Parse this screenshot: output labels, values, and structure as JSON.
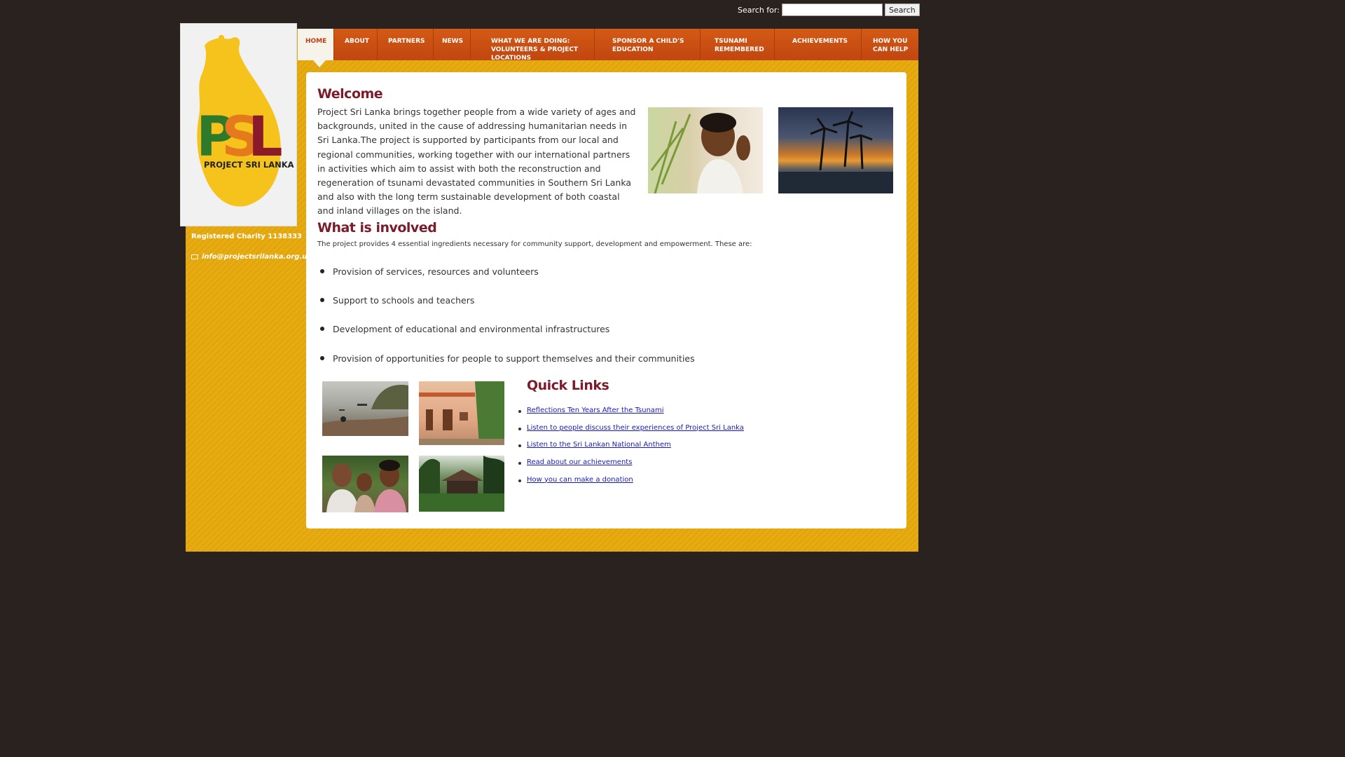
{
  "search": {
    "label": "Search for:",
    "value": "",
    "button": "Search"
  },
  "nav": {
    "items": [
      {
        "lines": [
          "HOME"
        ]
      },
      {
        "lines": [
          "ABOUT"
        ]
      },
      {
        "lines": [
          "PARTNERS"
        ]
      },
      {
        "lines": [
          "NEWS"
        ]
      },
      {
        "lines": [
          "WHAT WE ARE DOING:",
          "VOLUNTEERS & PROJECT",
          "LOCATIONS"
        ]
      },
      {
        "lines": [
          "SPONSOR A CHILD'S",
          "EDUCATION"
        ]
      },
      {
        "lines": [
          "TSUNAMI",
          "REMEMBERED"
        ]
      },
      {
        "lines": [
          "ACHIEVEMENTS"
        ]
      },
      {
        "lines": [
          "HOW YOU",
          "CAN HELP"
        ]
      }
    ],
    "active": "HOME"
  },
  "logo": {
    "letters": "PSL",
    "subtitle": "PROJECT SRI LANKA"
  },
  "sidebar": {
    "charity": "Registered Charity 1138333",
    "email": "info@projectsrilanka.org.uk"
  },
  "welcome": {
    "title": "Welcome",
    "body": "Project Sri Lanka brings together people from a wide variety of ages and backgrounds, united in the cause of addressing humanitarian needs in Sri Lanka.The project is supported by participants from our local and regional communities, working together with our international partners in activities which aim to assist with both the reconstruction and regeneration of tsunami devastated communities in Southern Sri Lanka and also with the long term sustainable development of both coastal and inland villages on the island."
  },
  "involved": {
    "title": "What is involved",
    "intro": "The project provides 4 essential ingredients necessary for community support, development and empowerment. These are:",
    "items": [
      "Provision of services, resources and volunteers",
      "Support to schools and teachers",
      "Development of educational and environmental infrastructures",
      "Provision of opportunities for people to support themselves and their communities"
    ]
  },
  "quick_links": {
    "title": "Quick Links",
    "items": [
      "Reflections Ten Years After the Tsunami",
      "Listen to people discuss their experiences of Project Sri Lanka",
      "Listen to the Sri Lankan National Anthem",
      "Read about our achievements",
      "How you can make a donation"
    ]
  },
  "colors": {
    "background": "#2a221f",
    "frame": "#e7ac12",
    "nav": "#c94f0e",
    "heading": "#7a1c2c",
    "link": "#1a1ab8"
  }
}
